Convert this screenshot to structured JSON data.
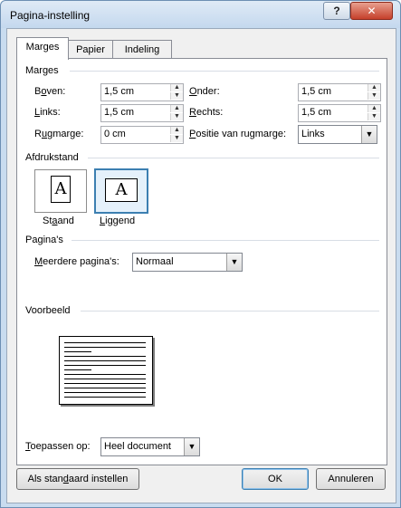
{
  "window": {
    "title": "Pagina-instelling",
    "help_glyph": "?",
    "close_glyph": "✕"
  },
  "tabs": [
    {
      "label": "Marges",
      "active": true
    },
    {
      "label": "Papier",
      "active": false
    },
    {
      "label": "Indeling",
      "active": false
    }
  ],
  "margins": {
    "heading": "Marges",
    "top": {
      "label_pre": "B",
      "label_u": "o",
      "label_post": "ven:",
      "value": "1,5 cm"
    },
    "left": {
      "label_pre": "",
      "label_u": "L",
      "label_post": "inks:",
      "value": "1,5 cm"
    },
    "gutter": {
      "label_pre": "R",
      "label_u": "u",
      "label_post": "gmarge:",
      "value": "0 cm"
    },
    "bottom": {
      "label_pre": "",
      "label_u": "O",
      "label_post": "nder:",
      "value": "1,5 cm"
    },
    "right": {
      "label_pre": "",
      "label_u": "R",
      "label_post": "echts:",
      "value": "1,5 cm"
    },
    "gutter_pos": {
      "label_pre": "",
      "label_u": "P",
      "label_post": "ositie van rugmarge:",
      "value": "Links"
    }
  },
  "orientation": {
    "heading": "Afdrukstand",
    "glyph": "A",
    "portrait": {
      "label_pre": "St",
      "label_u": "a",
      "label_post": "and"
    },
    "landscape": {
      "label_pre": "",
      "label_u": "L",
      "label_post": "iggend",
      "selected": true
    }
  },
  "pages": {
    "heading": "Pagina's",
    "multiple": {
      "label_pre": "",
      "label_u": "M",
      "label_post": "eerdere pagina's:",
      "value": "Normaal"
    }
  },
  "preview": {
    "heading": "Voorbeeld"
  },
  "apply": {
    "label_pre": "",
    "label_u": "T",
    "label_post": "oepassen op:",
    "value": "Heel document"
  },
  "footer": {
    "default_pre": "Als stan",
    "default_u": "d",
    "default_post": "aard instellen",
    "ok": "OK",
    "cancel": "Annuleren"
  },
  "colors": {
    "accent": "#3c7fb1",
    "titlebar": "#c9dcef",
    "close": "#c5402b"
  }
}
